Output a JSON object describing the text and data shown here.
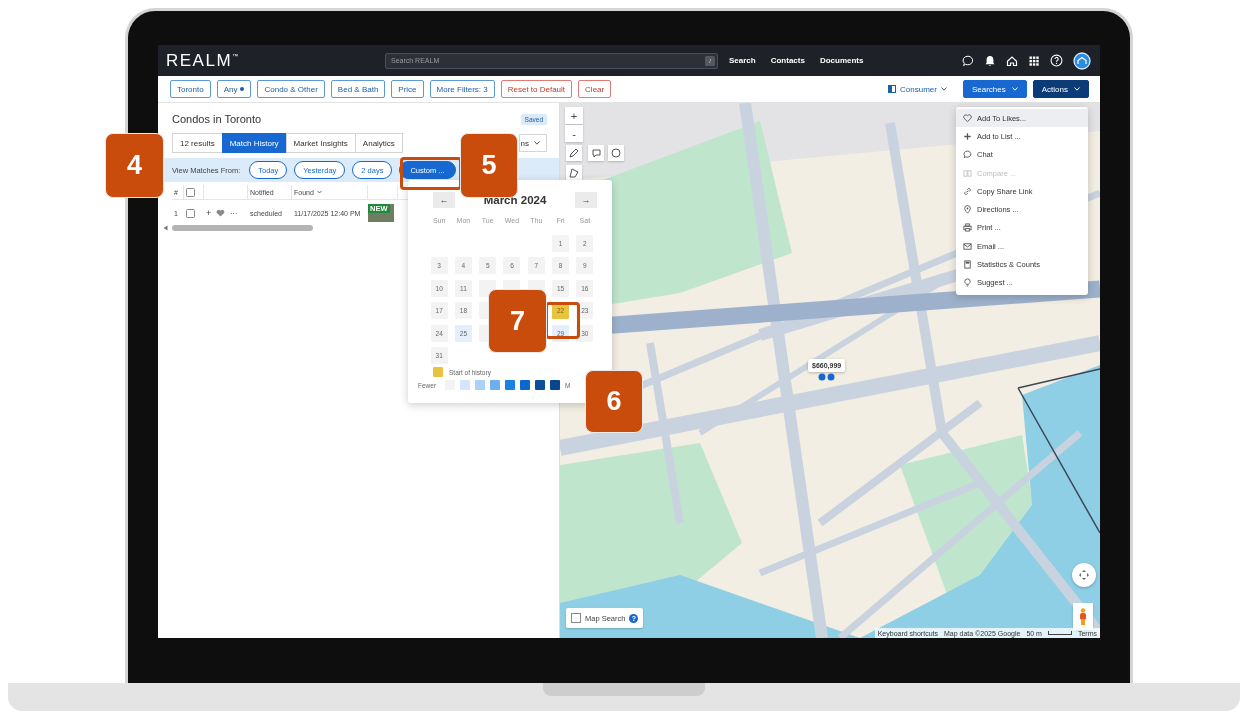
{
  "top_bar": {
    "logo": "REALM$^{™}$",
    "search": {
      "placeholder": "Search REALM",
      "shortcut": "/"
    },
    "nav": [
      {
        "label": "Search"
      },
      {
        "label": "Contacts"
      },
      {
        "label": "Documents"
      }
    ]
  },
  "filters": [
    {
      "label": "Toronto",
      "kind": "filter"
    },
    {
      "label": "Any",
      "kind": "dot"
    },
    {
      "label": "Condo & Other",
      "kind": "filter"
    },
    {
      "label": "Bed & Bath",
      "kind": "filter"
    },
    {
      "label": "Price",
      "kind": "filter"
    },
    {
      "label": "More Filters: 3",
      "kind": "filter"
    },
    {
      "label": "Reset to Default",
      "kind": "danger"
    },
    {
      "label": "Clear",
      "kind": "danger"
    }
  ],
  "view_controls": {
    "consumer": "Consumer",
    "searches": "Searches",
    "actions": "Actions"
  },
  "panel": {
    "title": "Condos in Toronto",
    "badge": "Saved",
    "tabs": [
      {
        "label": "12 results",
        "selected": false
      },
      {
        "label": "Match History",
        "selected": true
      },
      {
        "label": "Market Insights",
        "selected": false
      },
      {
        "label": "Analytics",
        "selected": false
      }
    ],
    "dropdown": "ns",
    "matches": {
      "label": "View Matches From:",
      "options": [
        {
          "label": "Today",
          "selected": false
        },
        {
          "label": "Yesterday",
          "selected": false
        },
        {
          "label": "2 days",
          "selected": false
        },
        {
          "label": "Custom ...",
          "selected": true
        }
      ]
    },
    "table": {
      "index_header": "#",
      "header_checked": false,
      "columns": [
        {
          "label": "Notified",
          "sortable": false
        },
        {
          "label": "Found",
          "sortable": true
        }
      ],
      "rows": [
        {
          "index": "1",
          "checked": false,
          "add": "+",
          "liked": false,
          "more": "···",
          "notified": "scheduled",
          "found": "11/17/2025 12:40 PM",
          "badge": "NEW"
        }
      ]
    }
  },
  "calendar": {
    "month": "March 2024",
    "prev": "←",
    "next": "→",
    "weekdays": [
      "Sun",
      "Mon",
      "Tue",
      "Wed",
      "Thu",
      "Fri",
      "Sat"
    ],
    "weeks": [
      [
        {
          "kind": "blank"
        },
        {
          "kind": "blank"
        },
        {
          "kind": "blank"
        },
        {
          "kind": "blank"
        },
        {
          "kind": "blank"
        },
        {
          "label": "1",
          "kind": "day"
        },
        {
          "label": "2",
          "kind": "day"
        }
      ],
      [
        {
          "label": "3",
          "kind": "day"
        },
        {
          "label": "4",
          "kind": "day"
        },
        {
          "label": "5",
          "kind": "day"
        },
        {
          "label": "6",
          "kind": "day"
        },
        {
          "label": "7",
          "kind": "day"
        },
        {
          "label": "8",
          "kind": "day"
        },
        {
          "label": "9",
          "kind": "day"
        }
      ],
      [
        {
          "label": "10",
          "kind": "day"
        },
        {
          "label": "11",
          "kind": "day"
        },
        {
          "kind": "covered"
        },
        {
          "kind": "covered"
        },
        {
          "kind": "covered"
        },
        {
          "label": "15",
          "kind": "day"
        },
        {
          "label": "16",
          "kind": "day"
        }
      ],
      [
        {
          "label": "17",
          "kind": "day"
        },
        {
          "label": "18",
          "kind": "day"
        },
        {
          "kind": "covered"
        },
        {
          "kind": "covered"
        },
        {
          "kind": "covered"
        },
        {
          "label": "22",
          "kind": "start"
        },
        {
          "label": "23",
          "kind": "day"
        }
      ],
      [
        {
          "label": "24",
          "kind": "day"
        },
        {
          "label": "25",
          "kind": "match"
        },
        {
          "kind": "covered"
        },
        {
          "kind": "covered"
        },
        {
          "kind": "covered"
        },
        {
          "label": "29",
          "kind": "match"
        },
        {
          "label": "30",
          "kind": "day"
        }
      ],
      [
        {
          "label": "31",
          "kind": "day"
        }
      ]
    ],
    "legend": {
      "start": "Start of history",
      "fewer": "Fewer",
      "more": "M",
      "scale": [
        {
          "color": "#f2f3f5"
        },
        {
          "color": "#d3e6fb"
        },
        {
          "color": "#acd1f7"
        },
        {
          "color": "#6eb0ef"
        },
        {
          "color": "#1a80e2"
        },
        {
          "color": "#0b68cc"
        },
        {
          "color": "#0a4f9c"
        },
        {
          "color": "#07468f"
        }
      ]
    }
  },
  "menu": [
    {
      "label": "Add To Likes...",
      "highlighted": true,
      "disabled": false
    },
    {
      "label": "Add to List ...",
      "highlighted": false,
      "disabled": false
    },
    {
      "label": "Chat",
      "highlighted": false,
      "disabled": false
    },
    {
      "label": "Compare ...",
      "highlighted": false,
      "disabled": true
    },
    {
      "label": "Copy Share Link",
      "highlighted": false,
      "disabled": false
    },
    {
      "label": "Directions ...",
      "highlighted": false,
      "disabled": false
    },
    {
      "label": "Print ...",
      "highlighted": false,
      "disabled": false
    },
    {
      "label": "Email ...",
      "highlighted": false,
      "disabled": false
    },
    {
      "label": "Statistics & Counts",
      "highlighted": false,
      "disabled": false
    },
    {
      "label": "Suggest ...",
      "highlighted": false,
      "disabled": false
    }
  ],
  "map": {
    "zoom_in": "+",
    "zoom_out": "-",
    "marker": "$660,999",
    "map_search": {
      "label": "Map Search",
      "checked": false,
      "help": "?"
    },
    "attribution": [
      "Keyboard shortcuts",
      "Map data ©2025 Google",
      "50 m",
      "Terms"
    ]
  },
  "callouts": [
    {
      "label": "4",
      "outlined": false
    },
    {
      "label": "5",
      "outlined": true
    },
    {
      "label": "6",
      "outlined": false
    },
    {
      "label": "7",
      "outlined": true
    }
  ]
}
